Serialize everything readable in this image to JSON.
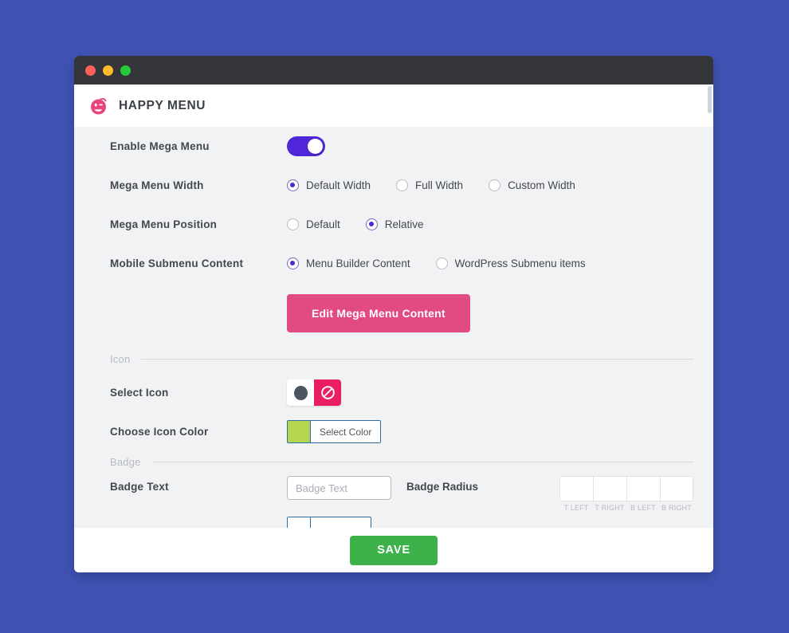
{
  "window": {
    "traffic_lights": [
      "close",
      "minimize",
      "maximize"
    ]
  },
  "header": {
    "logo_icon": "happy-face-logo",
    "title": "HAPPY MENU"
  },
  "settings": {
    "enable_mega_menu": {
      "label": "Enable Mega Menu",
      "value": "on"
    },
    "mega_menu_width": {
      "label": "Mega Menu Width",
      "options": [
        "Default Width",
        "Full Width",
        "Custom Width"
      ],
      "selected": "Default Width"
    },
    "mega_menu_position": {
      "label": "Mega Menu Position",
      "options": [
        "Default",
        "Relative"
      ],
      "selected": "Relative"
    },
    "mobile_submenu_content": {
      "label": "Mobile Submenu Content",
      "options": [
        "Menu Builder Content",
        "WordPress Submenu items"
      ],
      "selected": "Menu Builder Content"
    },
    "edit_content_button": "Edit Mega Menu Content"
  },
  "icon_section": {
    "divider_label": "Icon",
    "select_icon": {
      "label": "Select Icon",
      "preview_icon": "filled-circle-icon",
      "clear_icon": "no-entry-icon"
    },
    "icon_color": {
      "label": "Choose Icon Color",
      "button_label": "Select Color",
      "swatch_hex": "#b5d44f"
    }
  },
  "badge_section": {
    "divider_label": "Badge",
    "badge_text": {
      "label": "Badge Text",
      "placeholder": "Badge Text",
      "value": ""
    },
    "badge_radius": {
      "label": "Badge Radius",
      "corners": [
        {
          "caption": "T LEFT",
          "value": ""
        },
        {
          "caption": "T RIGHT",
          "value": ""
        },
        {
          "caption": "B LEFT",
          "value": ""
        },
        {
          "caption": "B RIGHT",
          "value": ""
        }
      ]
    }
  },
  "footer": {
    "save_label": "SAVE"
  },
  "colors": {
    "desktop_background": "#4053b5",
    "titlebar": "#343538",
    "panel": "#f1f2f4",
    "accent_purple": "#5027d8",
    "accent_pink": "#e14a82",
    "clear_pink": "#e91e63",
    "save_green": "#3eb24a",
    "swatch_green": "#b5d44f"
  }
}
